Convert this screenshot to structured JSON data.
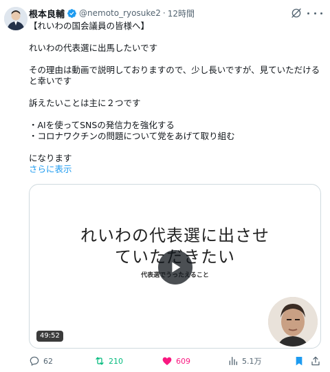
{
  "author": {
    "name": "根本良輔",
    "handle": "@nemoto_ryosuke2",
    "separator": "·",
    "time": "12時間"
  },
  "tweet": {
    "lines": [
      "【れいわの国会議員の皆様へ】",
      "",
      "れいわの代表選に出馬したいです",
      "",
      "その理由は動画で説明しておりますので、少し長いですが、見ていただける",
      "と幸いです",
      "",
      "訴えたいことは主に２つです",
      "",
      "・AIを使ってSNSの発信力を強化する",
      "・コロナワクチンの問題について党をあげて取り組む",
      "",
      "になります"
    ],
    "show_more": "さらに表示"
  },
  "video": {
    "title_line1": "れいわの代表選に出させ",
    "title_line2": "ていただきたい",
    "subtitle": "代表選でうったえること",
    "duration": "49:52"
  },
  "actions": {
    "replies": "62",
    "retweets": "210",
    "likes": "609",
    "views": "5.1万"
  },
  "colors": {
    "accent": "#1d9bf0",
    "retweet": "#00ba7c",
    "like": "#f91880",
    "bookmark": "#1d9bf0"
  }
}
